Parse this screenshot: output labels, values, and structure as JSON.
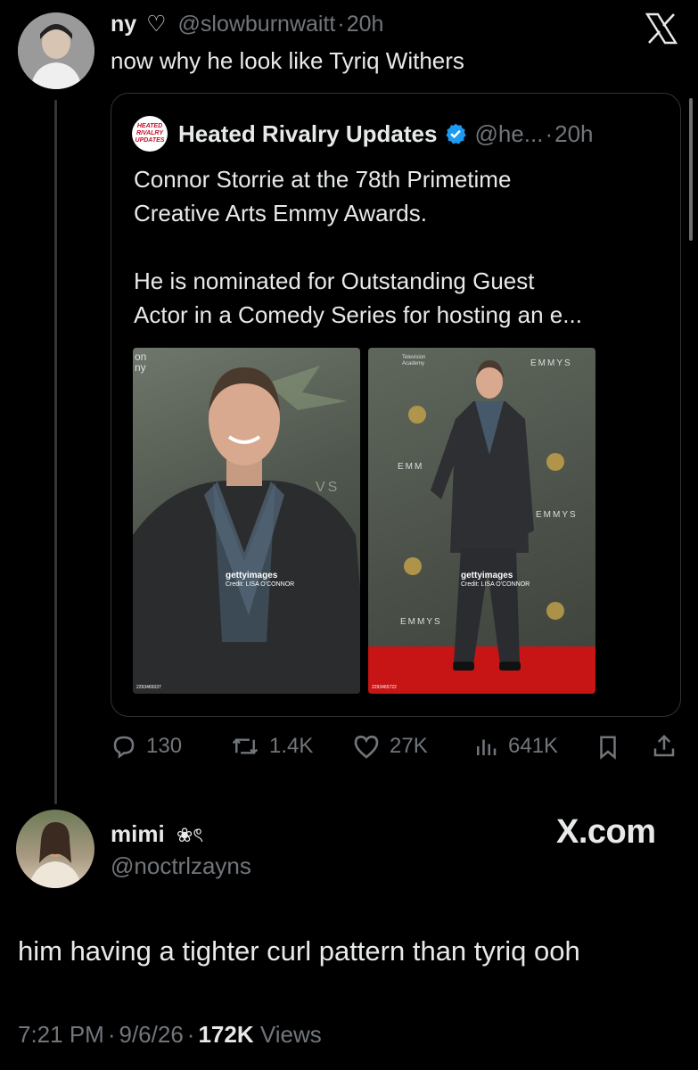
{
  "reply_tweet": {
    "display_name": "ny",
    "name_suffix": "♡",
    "handle": "@slowburnwaitt",
    "time": "20h",
    "text": "now why he look like Tyriq Withers"
  },
  "quoted_tweet": {
    "avatar_text": "HEATED RIVALRY UPDATES",
    "display_name": "Heated Rivalry Updates",
    "handle": "@he...",
    "time": "20h",
    "text_line1": "Connor Storrie at the 78th Primetime",
    "text_line2": "Creative Arts Emmy Awards.",
    "text_line3": "He is nominated for Outstanding Guest",
    "text_line4": "Actor in a Comedy Series for hosting an e...",
    "photo1": {
      "watermark": "gettyimages",
      "credit": "Credit: LISA O'CONNOR",
      "id": "2293465037",
      "corner_text": "on\nny",
      "backdrop_text": "VS"
    },
    "photo2": {
      "watermark": "gettyimages",
      "credit": "Credit: LISA O'CONNOR",
      "id": "2293465722",
      "backdrop_emmys": "EMMYS",
      "backdrop_academy": "Television Academy",
      "backdrop_emm": "EMM"
    }
  },
  "actions": {
    "replies": "130",
    "reposts": "1.4K",
    "likes": "27K",
    "views": "641K"
  },
  "main_tweet": {
    "display_name": "mimi",
    "name_emoji": "❀ৎ",
    "handle": "@noctrlzayns",
    "text": "him having a tighter curl pattern than tyriq ooh",
    "time": "7:21 PM",
    "date": "9/6/26",
    "views_count": "172K",
    "views_label": "Views"
  },
  "watermark": "X.com",
  "close_label": "X",
  "separator": "·",
  "colors": {
    "background": "#000000",
    "text": "#e7e9ea",
    "muted": "#71767b",
    "verified": "#1d9bf0",
    "border": "#2f3336"
  }
}
